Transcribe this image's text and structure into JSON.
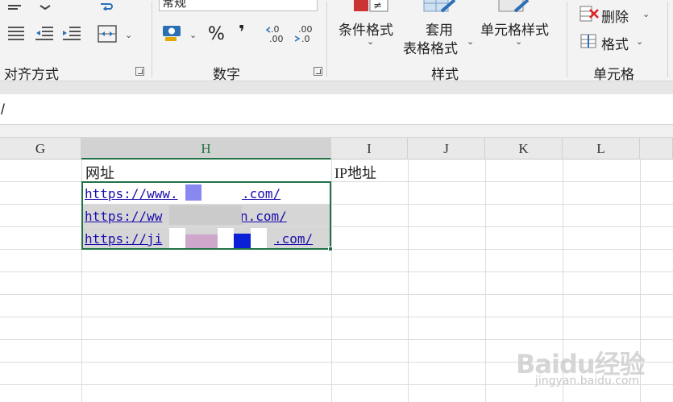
{
  "ribbon": {
    "alignment": {
      "label": "对齐方式"
    },
    "number": {
      "label": "数字",
      "format_value": "常规",
      "percent_label": "%",
      "comma_label": "❜",
      "increase_decimal_label": "←.0 .00",
      "decrease_decimal_label": ".00 →.0"
    },
    "styles": {
      "label": "样式",
      "conditional_format_label": "条件格式",
      "table_format_line1": "套用",
      "table_format_line2": "表格格式",
      "cell_styles_label": "单元格样式"
    },
    "cells": {
      "label": "单元格",
      "delete_label": "删除",
      "format_label": "格式"
    }
  },
  "formula_bar": {
    "content": "/"
  },
  "columns": [
    "G",
    "H",
    "I",
    "J",
    "K",
    "L"
  ],
  "selected_column": "H",
  "cells": {
    "H1": "网址",
    "I1": "IP地址",
    "H2": "https://www.",
    "H2_tail": ".com/",
    "H3": "https://ww",
    "H3_tail": "n.com/",
    "H4": "https://ji",
    "H4_tail": ".com/"
  },
  "watermark": {
    "brand": "Baidu经验",
    "url": "jingyan.baidu.com"
  },
  "colors": {
    "accent": "#217346",
    "link": "#1a0dab",
    "ribbon_bg": "#f3f3f3"
  }
}
